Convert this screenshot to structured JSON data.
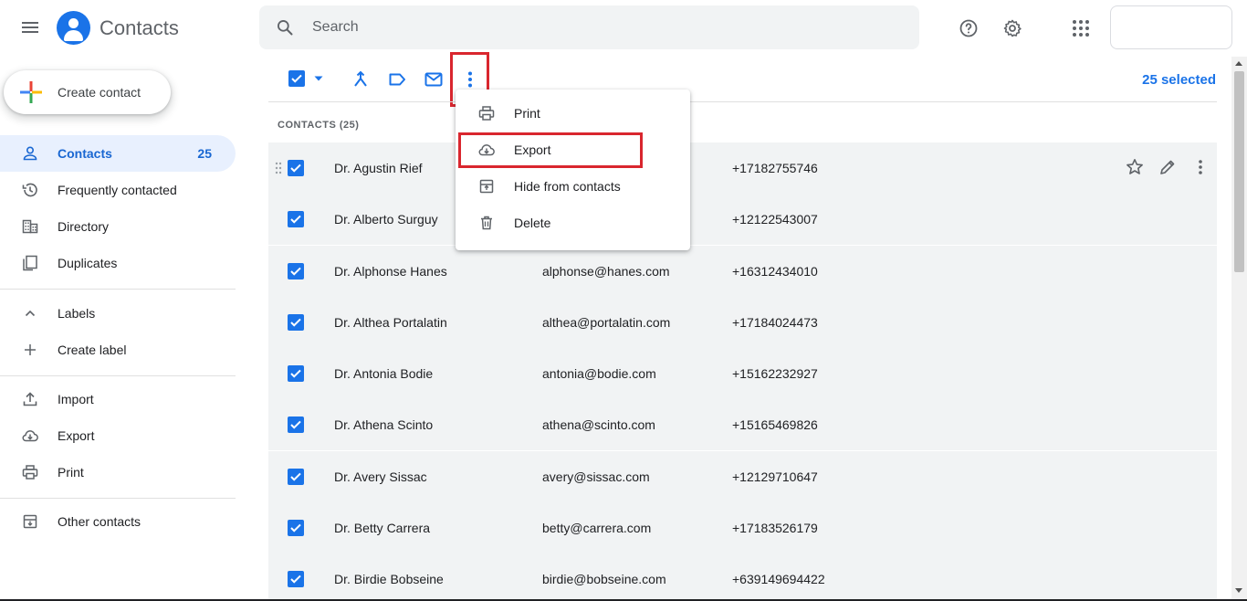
{
  "header": {
    "app_title": "Contacts",
    "search_placeholder": "Search"
  },
  "sidebar": {
    "create_label": "Create contact",
    "items": [
      {
        "label": "Contacts",
        "count": "25",
        "icon": "person-icon",
        "active": true
      },
      {
        "label": "Frequently contacted",
        "icon": "history-icon"
      },
      {
        "label": "Directory",
        "icon": "building-icon"
      },
      {
        "label": "Duplicates",
        "icon": "duplicate-icon"
      }
    ],
    "labels_section": {
      "labels": "Labels",
      "create_label": "Create label"
    },
    "tools": [
      {
        "label": "Import",
        "icon": "upload-icon"
      },
      {
        "label": "Export",
        "icon": "cloud-download-icon"
      },
      {
        "label": "Print",
        "icon": "printer-icon"
      }
    ],
    "other": "Other contacts"
  },
  "toolbar": {
    "selected_text": "25 selected",
    "list_header": "CONTACTS (25)"
  },
  "menu": {
    "items": [
      "Print",
      "Export",
      "Hide from contacts",
      "Delete"
    ]
  },
  "contacts": [
    {
      "name": "Dr. Agustin Rief",
      "email": "",
      "phone": "+17182755746"
    },
    {
      "name": "Dr. Alberto Surguy",
      "email": "",
      "phone": "+12122543007"
    },
    {
      "name": "Dr. Alphonse Hanes",
      "email": "alphonse@hanes.com",
      "phone": "+16312434010"
    },
    {
      "name": "Dr. Althea Portalatin",
      "email": "althea@portalatin.com",
      "phone": "+17184024473"
    },
    {
      "name": "Dr. Antonia Bodie",
      "email": "antonia@bodie.com",
      "phone": "+15162232927"
    },
    {
      "name": "Dr. Athena Scinto",
      "email": "athena@scinto.com",
      "phone": "+15165469826"
    },
    {
      "name": "Dr. Avery Sissac",
      "email": "avery@sissac.com",
      "phone": "+12129710647"
    },
    {
      "name": "Dr. Betty Carrera",
      "email": "betty@carrera.com",
      "phone": "+17183526179"
    },
    {
      "name": "Dr. Birdie Bobseine",
      "email": "birdie@bobseine.com",
      "phone": "+639149694422"
    }
  ],
  "colors": {
    "accent": "#1a73e8",
    "highlight": "#d9262e",
    "row_bg": "#f1f3f4"
  }
}
